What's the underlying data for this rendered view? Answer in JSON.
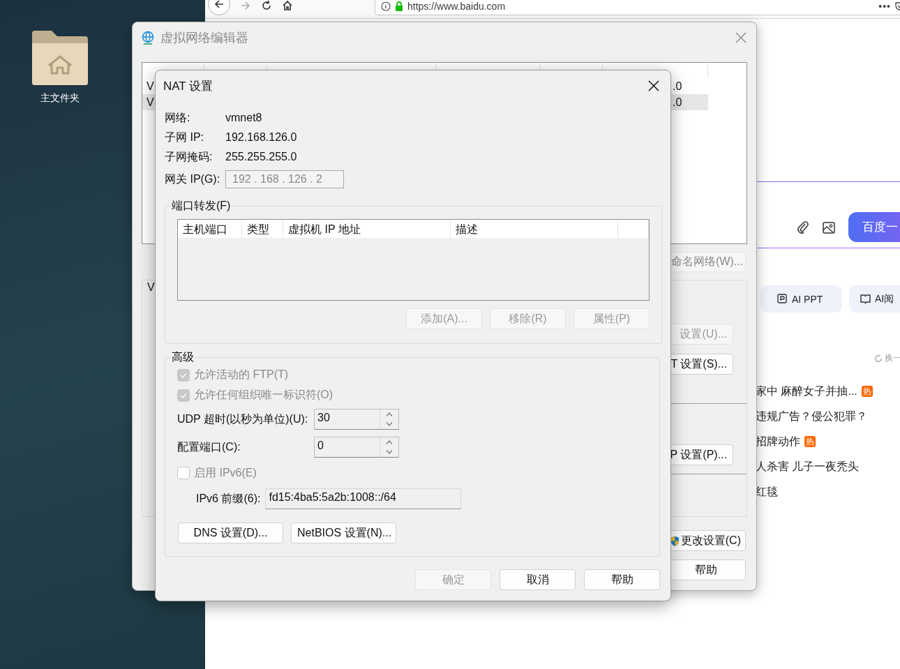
{
  "desktop": {
    "icons": [
      {
        "label": "主文件夹"
      }
    ]
  },
  "browser": {
    "url": "https://www.baidu.com",
    "page_menu": "•••",
    "search_button": "百度一",
    "chips": [
      "AI PPT",
      "AI阅"
    ],
    "refresh_label": "换一",
    "hot_list": [
      {
        "text": "家中 麻醉女子并抽...",
        "badge": "热"
      },
      {
        "text": "违规广告？侵公犯罪？"
      },
      {
        "text": "招牌动作",
        "badge": "热"
      },
      {
        "text": "人杀害 儿子一夜秃头"
      },
      {
        "text": "红毯"
      }
    ]
  },
  "network_editor": {
    "title": "虚拟网络编辑器",
    "rows": [
      {
        "name": "V",
        "subnet": ".0",
        "selected": false
      },
      {
        "name": "V",
        "subnet": ".0",
        "selected": true
      }
    ],
    "rename_button": "命名网络(W)...",
    "group_label": "V",
    "group_buttons": [
      {
        "label": "设置(U)...",
        "disabled": true
      },
      {
        "label": "T 设置(S)...",
        "disabled": false
      },
      {
        "label": "P 设置(P)...",
        "disabled": false
      }
    ],
    "change_settings": "更改设置(C)",
    "help_button": "帮助"
  },
  "nat_dialog": {
    "title": "NAT 设置",
    "info": [
      {
        "label": "网络:",
        "value": "vmnet8"
      },
      {
        "label": "子网 IP:",
        "value": "192.168.126.0"
      },
      {
        "label": "子网掩码:",
        "value": "255.255.255.0"
      }
    ],
    "gateway": {
      "label": "网关 IP(G):",
      "value": "192 . 168 . 126 .  2",
      "disabled": true
    },
    "port_forwarding": {
      "legend": "端口转发(F)",
      "columns": [
        "主机端口",
        "类型",
        "虚拟机 IP 地址",
        "描述"
      ],
      "buttons": [
        {
          "label": "添加(A)...",
          "disabled": true
        },
        {
          "label": "移除(R)",
          "disabled": true
        },
        {
          "label": "属性(P)",
          "disabled": true
        }
      ]
    },
    "advanced": {
      "legend": "高级",
      "options": [
        {
          "kind": "checkbox",
          "label": "允许活动的 FTP(T)",
          "checked": true,
          "disabled": true
        },
        {
          "kind": "checkbox",
          "label": "允许任何组织唯一标识符(O)",
          "checked": true,
          "disabled": true
        },
        {
          "kind": "spin",
          "label": "UDP 超时(以秒为单位)(U):",
          "value": "30"
        },
        {
          "kind": "spin",
          "label": "配置端口(C):",
          "value": "0"
        },
        {
          "kind": "checkbox",
          "label": "启用 IPv6(E)",
          "checked": false,
          "disabled": true
        },
        {
          "kind": "field",
          "label": "IPv6 前缀(6):",
          "value": "fd15:4ba5:5a2b:1008::/64"
        }
      ],
      "buttons": [
        "DNS 设置(D)...",
        "NetBIOS 设置(N)..."
      ]
    },
    "buttons": [
      {
        "label": "确定",
        "disabled": true
      },
      {
        "label": "取消",
        "disabled": false
      },
      {
        "label": "帮助",
        "disabled": false
      }
    ]
  }
}
